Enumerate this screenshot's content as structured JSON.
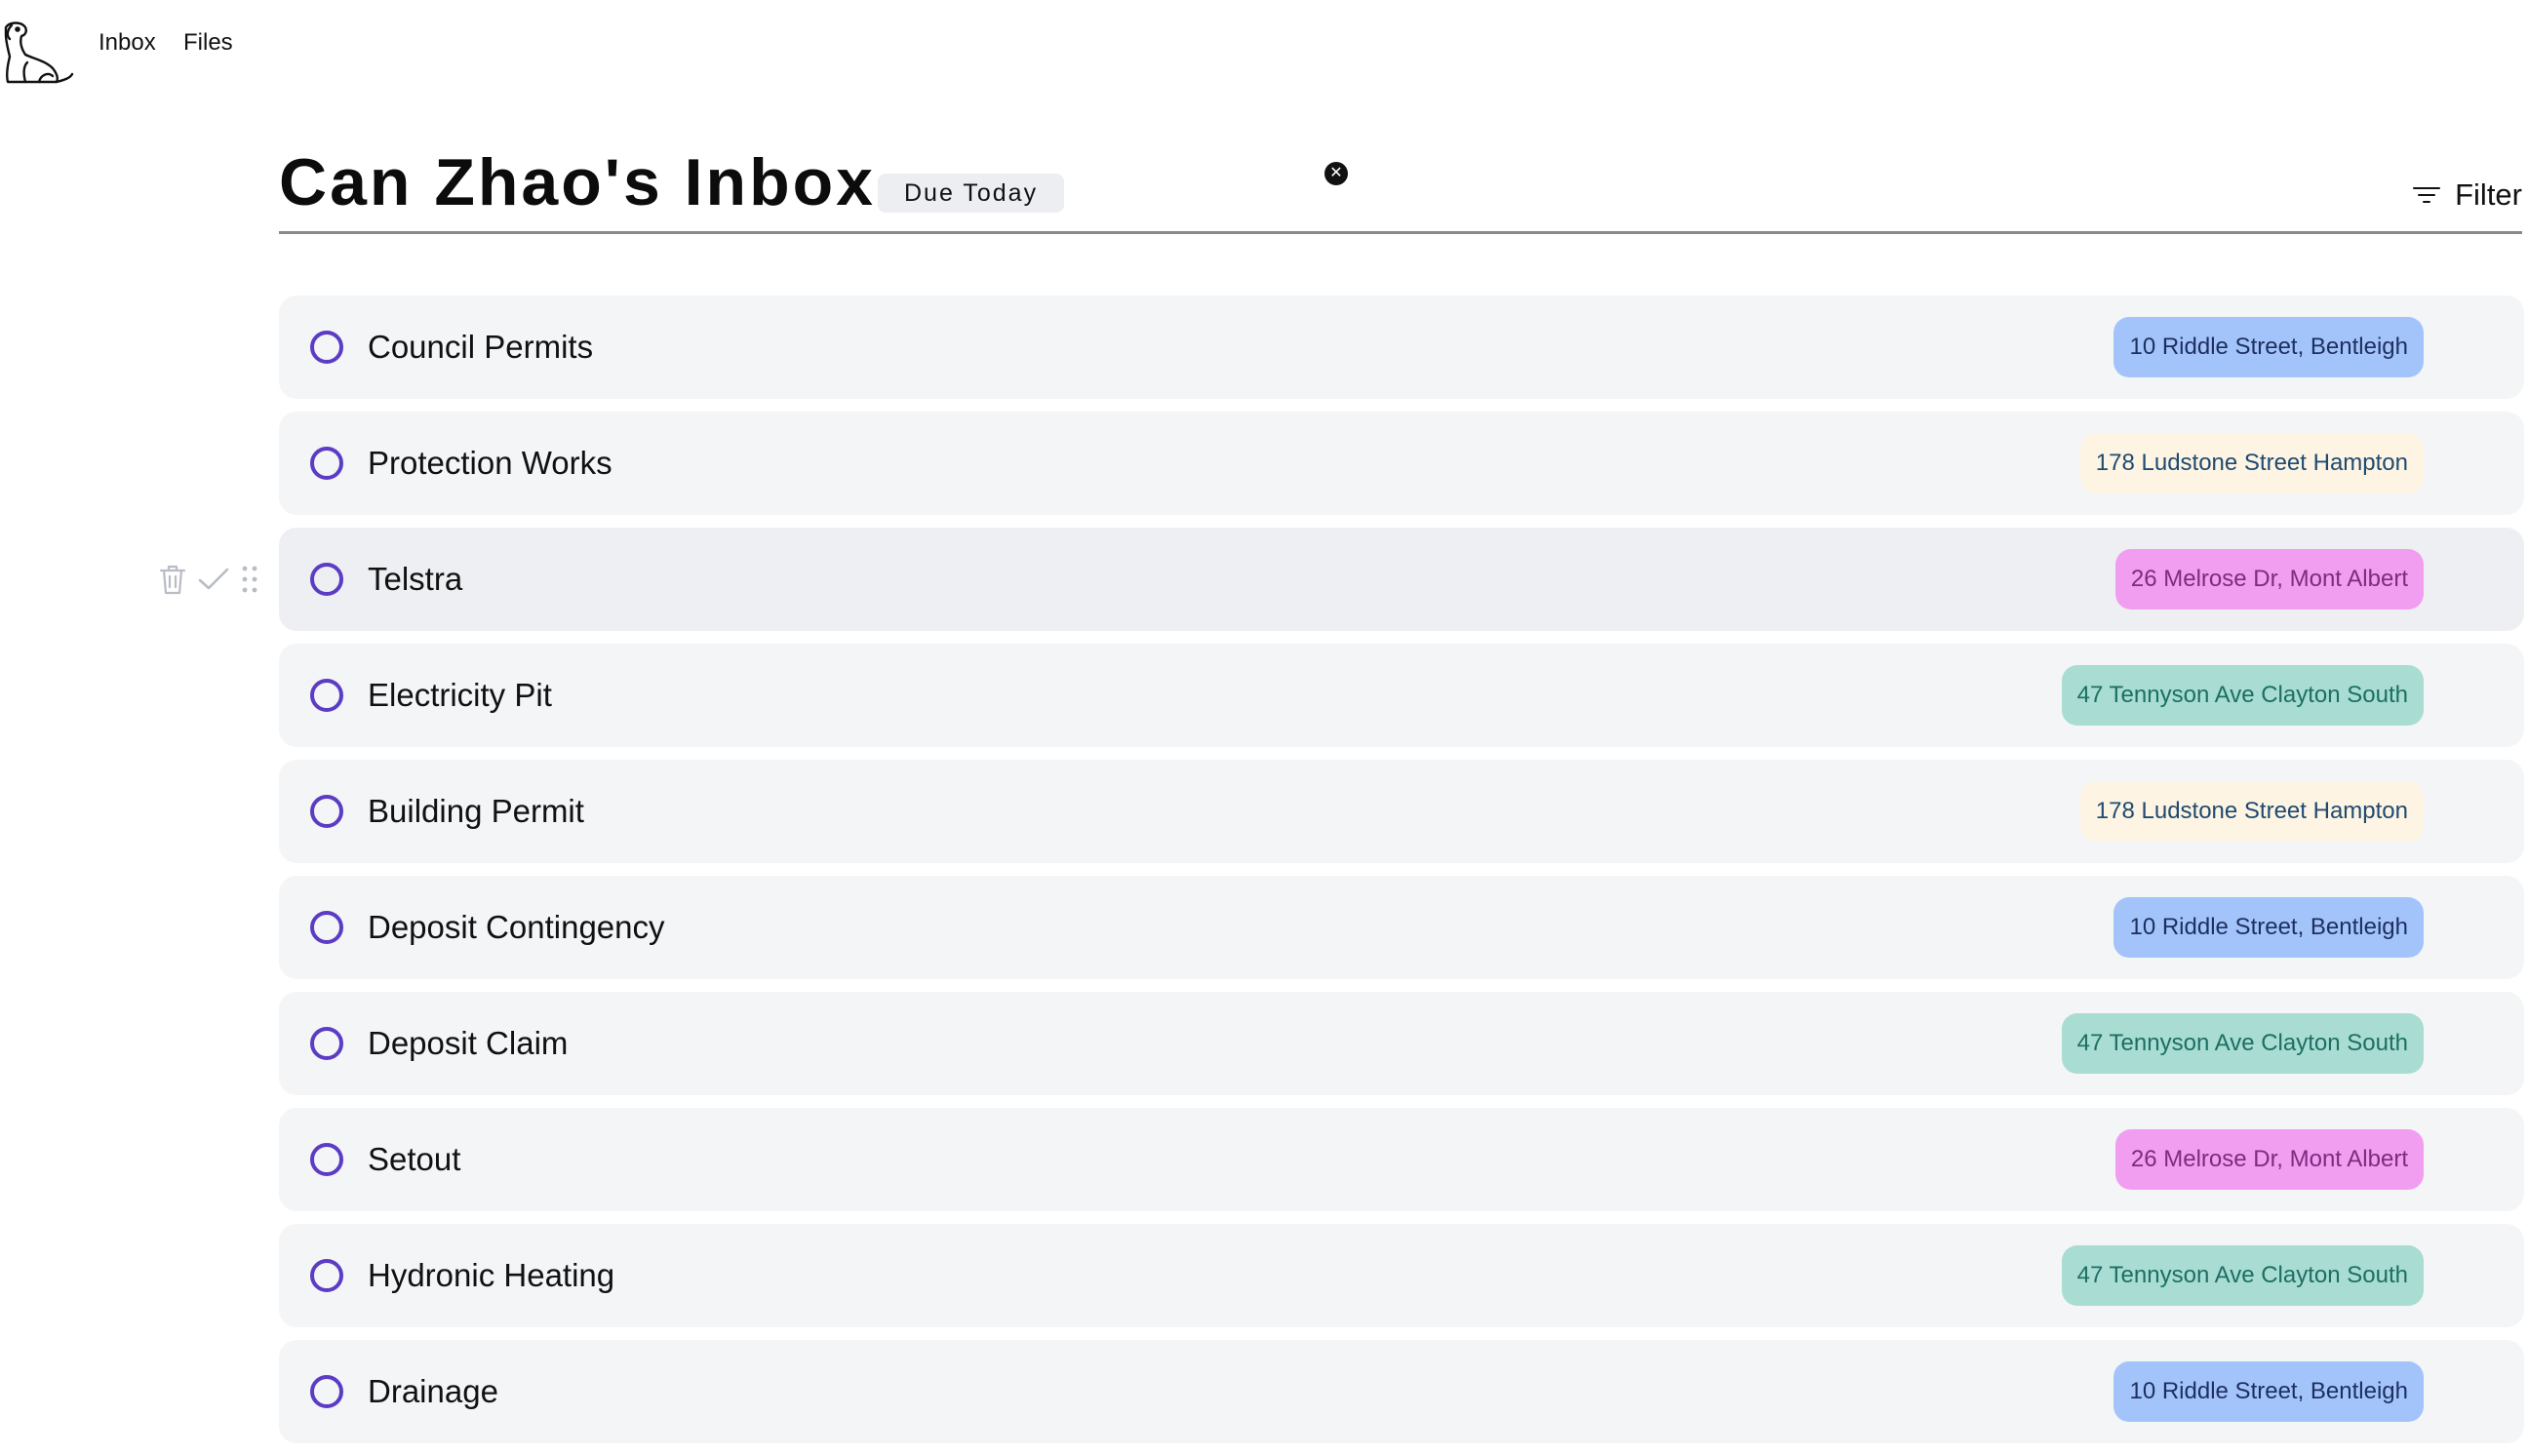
{
  "nav": {
    "logo_name": "dog-logo",
    "items": [
      {
        "label": "Inbox"
      },
      {
        "label": "Files"
      }
    ]
  },
  "header": {
    "title": "Can Zhao's Inbox",
    "active_filter_chip": "Due Today",
    "filter_label": "Filter"
  },
  "colors": {
    "accent": "#5b3cc4",
    "row_background": "#f4f5f7",
    "tag_blue": "#a3c4fb",
    "tag_cream": "#fdf4e3",
    "tag_pink": "#f19ef1",
    "tag_teal": "#a9dcd2"
  },
  "tasks": [
    {
      "title": "Council Permits",
      "address": "10 Riddle Street, Bentleigh",
      "tag_color": "blue"
    },
    {
      "title": "Protection Works",
      "address": "178 Ludstone Street Hampton",
      "tag_color": "cream"
    },
    {
      "title": "Telstra",
      "address": "26 Melrose Dr, Mont Albert",
      "tag_color": "pink",
      "hovered": true
    },
    {
      "title": "Electricity Pit",
      "address": "47 Tennyson Ave Clayton South",
      "tag_color": "teal"
    },
    {
      "title": "Building Permit",
      "address": "178 Ludstone Street Hampton",
      "tag_color": "cream"
    },
    {
      "title": "Deposit Contingency",
      "address": "10 Riddle Street, Bentleigh",
      "tag_color": "blue"
    },
    {
      "title": "Deposit Claim",
      "address": "47 Tennyson Ave Clayton South",
      "tag_color": "teal"
    },
    {
      "title": "Setout",
      "address": "26 Melrose Dr, Mont Albert",
      "tag_color": "pink"
    },
    {
      "title": "Hydronic Heating",
      "address": "47 Tennyson Ave Clayton South",
      "tag_color": "teal"
    },
    {
      "title": "Drainage",
      "address": "10 Riddle Street, Bentleigh",
      "tag_color": "blue"
    }
  ],
  "row_actions": {
    "icons": [
      "trash-icon",
      "check-icon",
      "drag-handle-icon"
    ]
  }
}
